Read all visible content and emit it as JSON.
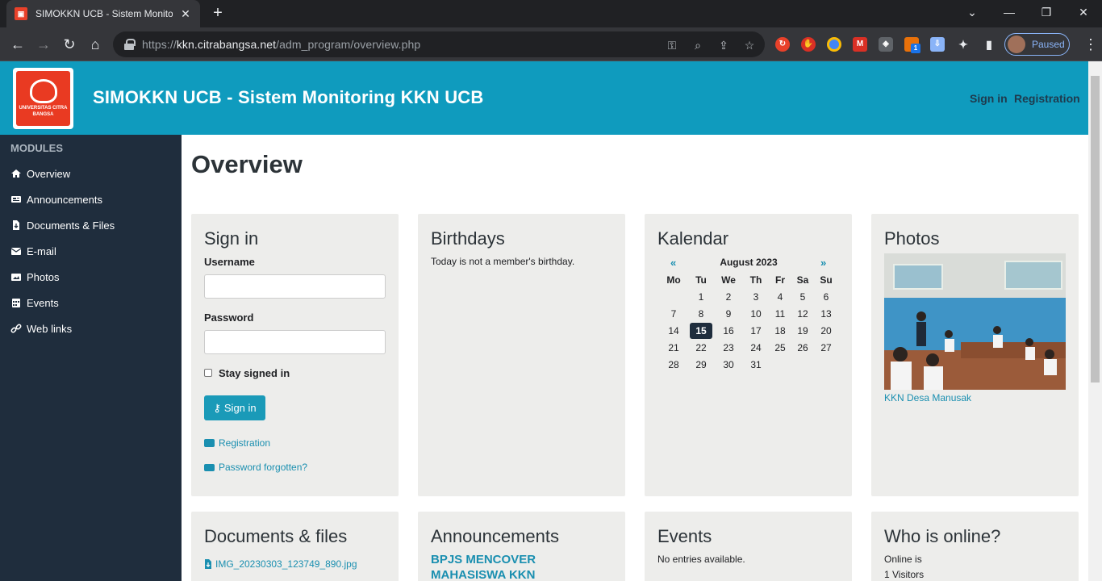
{
  "browser": {
    "tab_title": "SIMOKKN UCB - Sistem Monitoring KKN UCB",
    "url_prefix": "https://",
    "url_domain": "kkn.citrabangsa.net",
    "url_path": "/adm_program/overview.php",
    "profile_status": "Paused",
    "extension_badge": "1"
  },
  "header": {
    "site_title": "SIMOKKN UCB - Sistem Monitoring KKN UCB",
    "logo_text": "UNIVERSITAS CITRA BANGSA",
    "sign_in": "Sign in",
    "registration": "Registration"
  },
  "sidebar": {
    "heading": "MODULES",
    "items": [
      {
        "label": "Overview",
        "icon": "home-icon"
      },
      {
        "label": "Announcements",
        "icon": "newspaper-icon"
      },
      {
        "label": "Documents & Files",
        "icon": "file-download-icon"
      },
      {
        "label": "E-mail",
        "icon": "envelope-icon"
      },
      {
        "label": "Photos",
        "icon": "image-icon"
      },
      {
        "label": "Events",
        "icon": "calendar-icon"
      },
      {
        "label": "Web links",
        "icon": "link-icon"
      }
    ]
  },
  "main": {
    "title": "Overview",
    "signin": {
      "heading": "Sign in",
      "username_label": "Username",
      "password_label": "Password",
      "stay_signed": "Stay signed in",
      "button": "Sign in",
      "registration_link": "Registration",
      "forgot_link": "Password forgotten?"
    },
    "birthdays": {
      "heading": "Birthdays",
      "text": "Today is not a member's birthday."
    },
    "calendar": {
      "heading": "Kalendar",
      "month": "August 2023",
      "prev": "«",
      "next": "»",
      "weekdays": [
        "Mo",
        "Tu",
        "We",
        "Th",
        "Fr",
        "Sa",
        "Su"
      ],
      "weeks": [
        [
          "",
          "1",
          "2",
          "3",
          "4",
          "5",
          "6"
        ],
        [
          "7",
          "8",
          "9",
          "10",
          "11",
          "12",
          "13"
        ],
        [
          "14",
          "15",
          "16",
          "17",
          "18",
          "19",
          "20"
        ],
        [
          "21",
          "22",
          "23",
          "24",
          "25",
          "26",
          "27"
        ],
        [
          "28",
          "29",
          "30",
          "31",
          "",
          "",
          ""
        ]
      ],
      "today": "15"
    },
    "photos": {
      "heading": "Photos",
      "caption": "KKN Desa Manusak"
    },
    "documents": {
      "heading": "Documents & files",
      "file": "IMG_20230303_123749_890.jpg"
    },
    "announcements": {
      "heading": "Announcements",
      "item": "BPJS MENCOVER MAHASISWA KKN"
    },
    "events": {
      "heading": "Events",
      "text": "No entries available."
    },
    "online": {
      "heading": "Who is online?",
      "line1": "Online is",
      "line2": "1 Visitors"
    }
  },
  "colors": {
    "header_bg": "#0f9bbe",
    "sidebar_bg": "#1f2d3d",
    "card_bg": "#ededeb",
    "link": "#1a8fb0"
  }
}
